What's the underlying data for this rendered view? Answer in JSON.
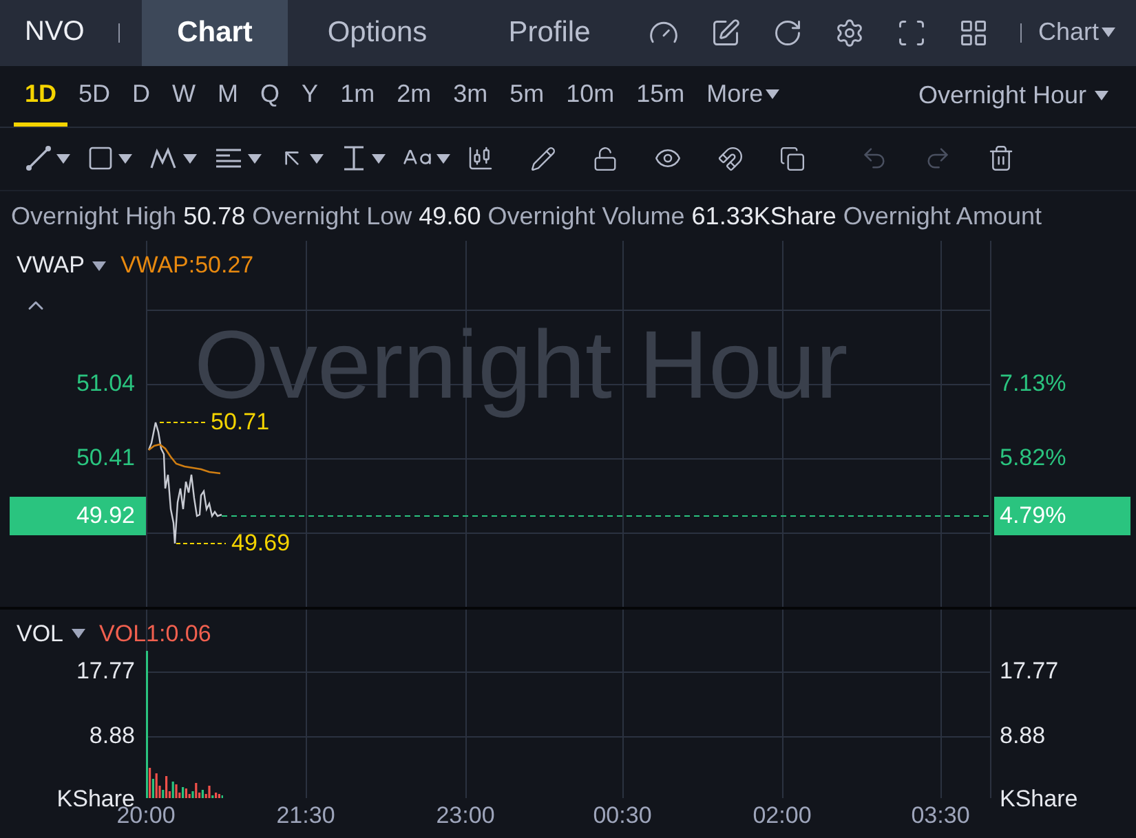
{
  "header": {
    "symbol": "NVO",
    "tabs": [
      {
        "label": "Chart",
        "selected": true
      },
      {
        "label": "Options",
        "selected": false
      },
      {
        "label": "Profile",
        "selected": false
      }
    ],
    "view_menu": "Chart"
  },
  "periods": [
    {
      "label": "1D",
      "selected": true,
      "kind": "period"
    },
    {
      "label": "5D",
      "selected": false,
      "kind": "period"
    },
    {
      "label": "D",
      "selected": false,
      "kind": "period"
    },
    {
      "label": "W",
      "selected": false,
      "kind": "period"
    },
    {
      "label": "M",
      "selected": false,
      "kind": "period"
    },
    {
      "label": "Q",
      "selected": false,
      "kind": "period"
    },
    {
      "label": "Y",
      "selected": false,
      "kind": "period"
    },
    {
      "label": "1m",
      "selected": false,
      "kind": "period"
    },
    {
      "label": "2m",
      "selected": false,
      "kind": "period"
    },
    {
      "label": "3m",
      "selected": false,
      "kind": "period"
    },
    {
      "label": "5m",
      "selected": false,
      "kind": "period"
    },
    {
      "label": "10m",
      "selected": false,
      "kind": "period"
    },
    {
      "label": "15m",
      "selected": false,
      "kind": "period"
    },
    {
      "label": "More",
      "selected": false,
      "kind": "menu"
    }
  ],
  "session_menu": "Overnight Hour",
  "history": {
    "undo_disabled": true,
    "redo_disabled": true
  },
  "stats": [
    {
      "label": "Overnight High",
      "value": "50.78"
    },
    {
      "label": "Overnight Low",
      "value": "49.60"
    },
    {
      "label": "Overnight Volume",
      "value": "61.33KShare"
    },
    {
      "label": "Overnight Amount"
    }
  ],
  "price_panel": {
    "indicator": "VWAP",
    "reading": "VWAP:50.27",
    "watermark": "Overnight Hour",
    "left_ticks": [
      "51.04",
      "50.41"
    ],
    "right_ticks": [
      "7.13%",
      "5.82%"
    ],
    "high_label": "50.71",
    "low_label": "49.69",
    "last_price": "49.92",
    "last_change": "4.79%"
  },
  "volume_panel": {
    "indicator": "VOL",
    "reading": "VOL1:0.06",
    "left_ticks": [
      "17.77",
      "8.88",
      "KShare"
    ],
    "right_ticks": [
      "17.77",
      "8.88",
      "KShare"
    ]
  },
  "time_axis": [
    "20:00",
    "21:30",
    "23:00",
    "00:30",
    "02:00",
    "03:30"
  ]
}
